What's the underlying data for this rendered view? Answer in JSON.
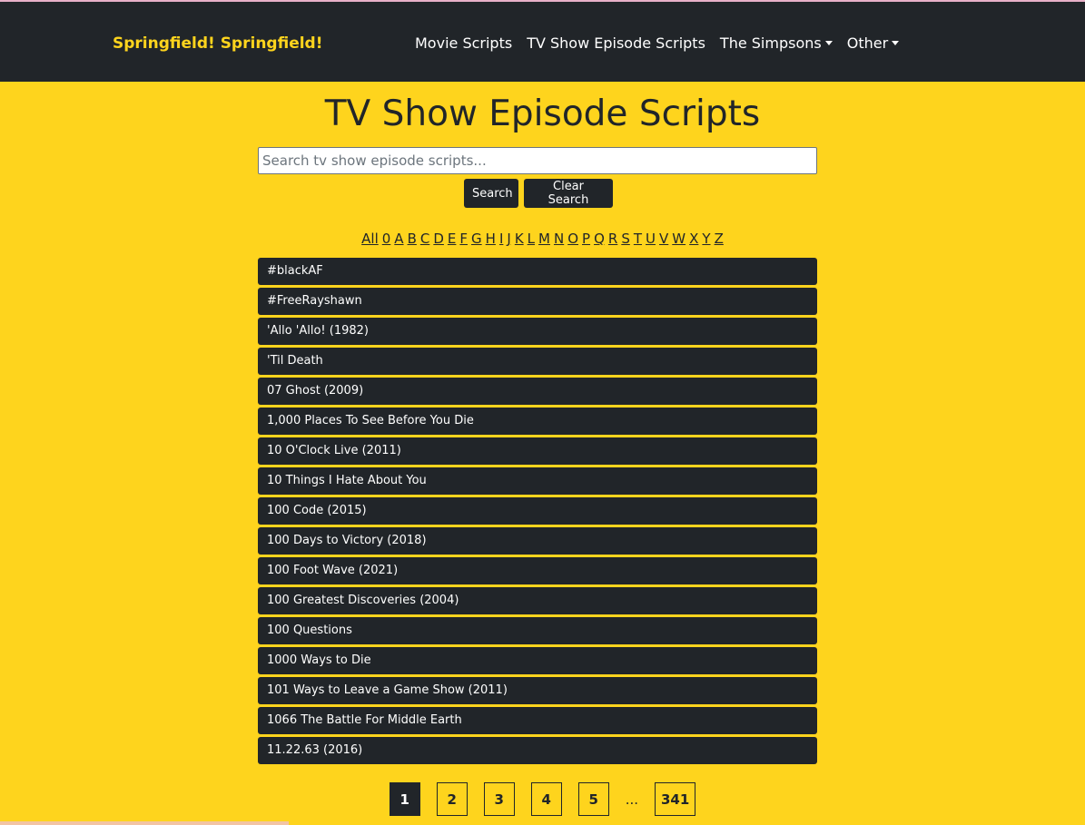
{
  "header": {
    "brand": "Springfield! Springfield!",
    "nav": [
      {
        "label": "Movie Scripts",
        "dropdown": false
      },
      {
        "label": "TV Show Episode Scripts",
        "dropdown": false
      },
      {
        "label": "The Simpsons",
        "dropdown": true
      },
      {
        "label": "Other",
        "dropdown": true
      }
    ]
  },
  "main": {
    "title": "TV Show Episode Scripts",
    "search": {
      "placeholder": "Search tv show episode scripts...",
      "value": "",
      "search_label": "Search",
      "clear_label": "Clear Search"
    },
    "alphabet": [
      "All",
      "0",
      "A",
      "B",
      "C",
      "D",
      "E",
      "F",
      "G",
      "H",
      "I",
      "J",
      "K",
      "L",
      "M",
      "N",
      "O",
      "P",
      "Q",
      "R",
      "S",
      "T",
      "U",
      "V",
      "W",
      "X",
      "Y",
      "Z"
    ],
    "shows": [
      "#blackAF",
      "#FreeRayshawn",
      "'Allo 'Allo! (1982)",
      "'Til Death",
      "07 Ghost (2009)",
      "1,000 Places To See Before You Die",
      "10 O'Clock Live (2011)",
      "10 Things I Hate About You",
      "100 Code (2015)",
      "100 Days to Victory (2018)",
      "100 Foot Wave (2021)",
      "100 Greatest Discoveries (2004)",
      "100 Questions",
      "1000 Ways to Die",
      "101 Ways to Leave a Game Show (2011)",
      "1066 The Battle For Middle Earth",
      "11.22.63 (2016)"
    ],
    "pagination": {
      "pages": [
        "1",
        "2",
        "3",
        "4",
        "5"
      ],
      "ellipsis": "...",
      "last": "341",
      "current": "1"
    }
  },
  "colors": {
    "background": "#fed41d",
    "dark": "#212529",
    "brand": "#fed41d"
  }
}
